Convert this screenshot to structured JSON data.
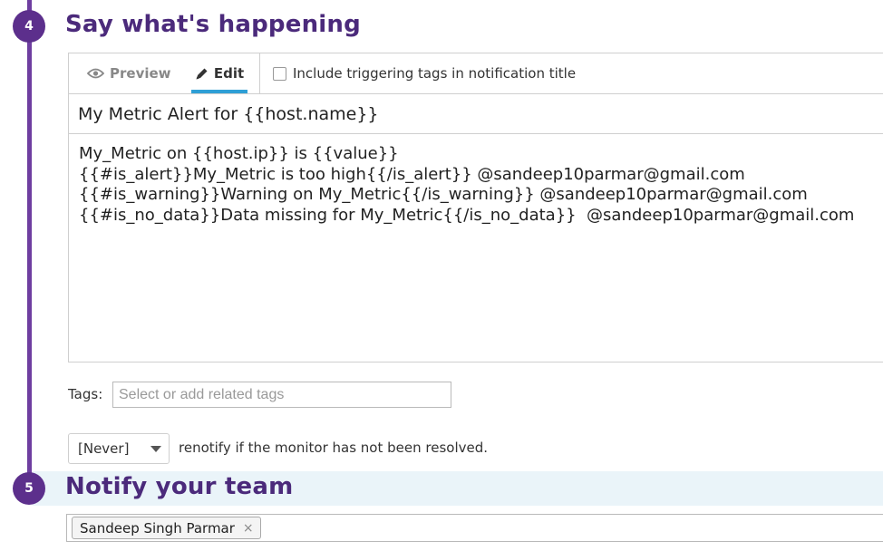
{
  "steps": {
    "four": {
      "number": "4",
      "title": "Say what's happening"
    },
    "five": {
      "number": "5",
      "title": "Notify your team"
    }
  },
  "editor": {
    "tabs": [
      {
        "label": "Preview",
        "icon": "eye-icon"
      },
      {
        "label": "Edit",
        "icon": "pencil-icon",
        "active": true
      }
    ],
    "include_tags_label": "Include triggering tags in notification title",
    "include_tags_checked": false,
    "title_value": "My Metric Alert for {{host.name}}",
    "body_lines": [
      "My_Metric on {{host.ip}} is {{value}}",
      "{{#is_alert}}My_Metric is too high{{/is_alert}} @sandeep10parmar@gmail.com",
      "{{#is_warning}}Warning on My_Metric{{/is_warning}} @sandeep10parmar@gmail.com",
      "{{#is_no_data}}Data missing for My_Metric{{/is_no_data}}  @sandeep10parmar@gmail.com"
    ]
  },
  "tags": {
    "label": "Tags:",
    "placeholder": "Select or add related tags"
  },
  "renotify": {
    "selected": "[Never]",
    "text": "renotify if the monitor has not been resolved."
  },
  "notify": {
    "recipients": [
      {
        "name": "Sandeep Singh Parmar",
        "remove": "×"
      }
    ]
  },
  "colors": {
    "accent_purple": "#5c2f8c",
    "title_purple": "#4b2a7b",
    "tab_underline": "#2e9fd6",
    "band": "#eaf4f9"
  }
}
